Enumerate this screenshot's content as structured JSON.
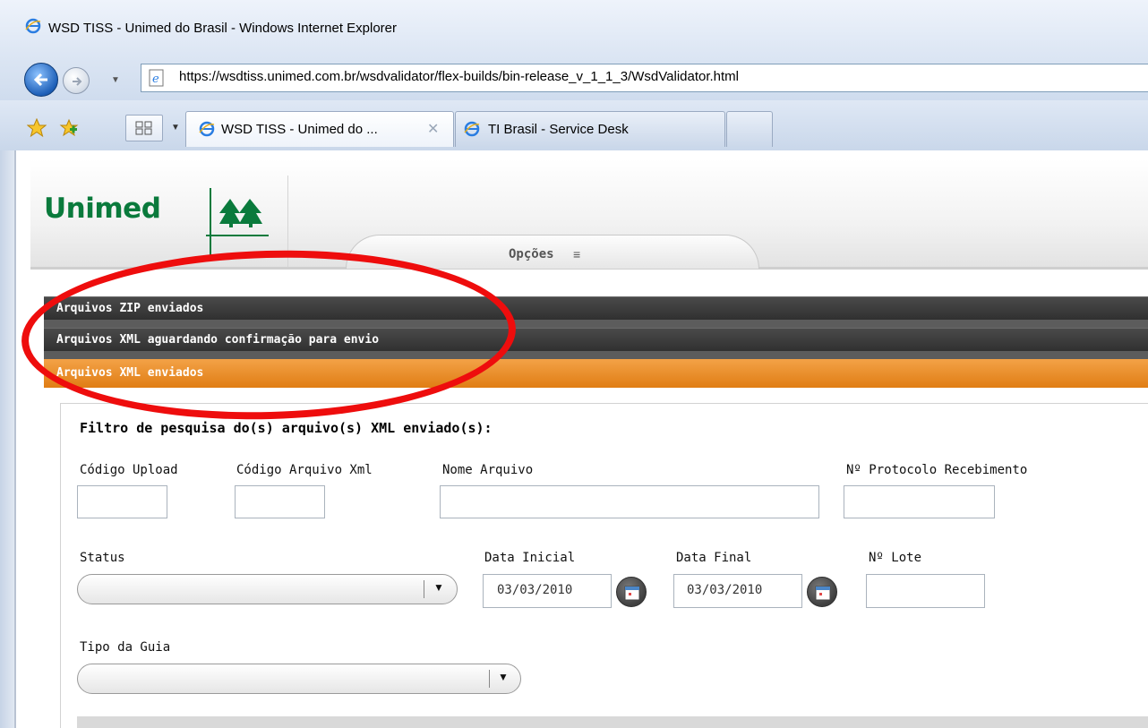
{
  "window": {
    "title": "WSD TISS - Unimed do Brasil - Windows Internet Explorer"
  },
  "navigation": {
    "address": "https://wsdtiss.unimed.com.br/wsdvalidator/flex-builds/bin-release_v_1_1_3/WsdValidator.html"
  },
  "tabs": [
    {
      "label": "WSD TISS - Unimed do ...",
      "active": true
    },
    {
      "label": "TI Brasil - Service Desk",
      "active": false
    }
  ],
  "header": {
    "logo_text": "Unimed",
    "options_label": "Opções",
    "options_icon": "menu-lines-icon"
  },
  "accordion": [
    {
      "label": "Arquivos ZIP enviados",
      "color": "#3a3a3a"
    },
    {
      "label": "Arquivos XML aguardando confirmação para envio",
      "color": "#3a3a3a"
    },
    {
      "label": "Arquivos XML enviados",
      "color": "#ec8a24"
    }
  ],
  "filter": {
    "title": "Filtro de pesquisa do(s) arquivo(s) XML enviado(s):",
    "fields": {
      "codigo_upload": {
        "label": "Código Upload",
        "value": ""
      },
      "codigo_xml": {
        "label": "Código Arquivo Xml",
        "value": ""
      },
      "nome_arquivo": {
        "label": "Nome Arquivo",
        "value": ""
      },
      "protocolo": {
        "label": "Nº Protocolo Recebimento",
        "value": ""
      },
      "status": {
        "label": "Status",
        "value": ""
      },
      "data_inicial": {
        "label": "Data Inicial",
        "value": "03/03/2010"
      },
      "data_final": {
        "label": "Data Final",
        "value": "03/03/2010"
      },
      "lote": {
        "label": "Nº Lote",
        "value": ""
      },
      "tipo_guia": {
        "label": "Tipo da Guia",
        "value": ""
      }
    }
  },
  "colors": {
    "brand_green": "#0a7a3c",
    "annotation_red": "#ee0d0d",
    "active_section": "#ec8a24"
  }
}
